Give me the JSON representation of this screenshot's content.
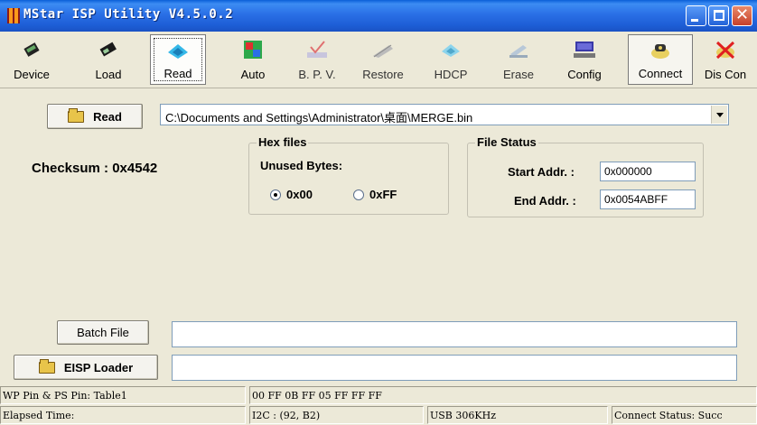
{
  "window": {
    "title": "MStar ISP Utility V4.5.0.2"
  },
  "toolbar": [
    {
      "label": "Device",
      "icon": "device-icon"
    },
    {
      "label": "Load",
      "icon": "load-icon"
    },
    {
      "label": "Read",
      "icon": "read-icon"
    },
    {
      "label": "Auto",
      "icon": "auto-icon"
    },
    {
      "label": "B. P. V.",
      "icon": "bpv-icon"
    },
    {
      "label": "Restore",
      "icon": "restore-icon"
    },
    {
      "label": "HDCP",
      "icon": "hdcp-icon"
    },
    {
      "label": "Erase",
      "icon": "erase-icon"
    },
    {
      "label": "Config",
      "icon": "config-icon"
    },
    {
      "label": "Connect",
      "icon": "connect-icon"
    },
    {
      "label": "Dis Con",
      "icon": "disconnect-icon"
    }
  ],
  "read_panel": {
    "read_button": "Read",
    "file_path": "C:\\Documents and Settings\\Administrator\\桌面\\MERGE.bin",
    "checksum": "Checksum : 0x4542"
  },
  "hex_files": {
    "legend": "Hex files",
    "unused_label": "Unused Bytes:",
    "option_00": "0x00",
    "option_ff": "0xFF"
  },
  "file_status": {
    "legend": "File Status",
    "start_label": "Start Addr. :",
    "start_value": "0x000000",
    "end_label": "End Addr. :",
    "end_value": "0x0054ABFF"
  },
  "bottom": {
    "batch_button": "Batch File",
    "batch_value": "",
    "eisp_button": "EISP Loader",
    "eisp_value": ""
  },
  "status_bar": {
    "wp_pin": "WP Pin & PS Pin: Table1",
    "hex_bytes": "00  FF  0B  FF  05  FF  FF  FF",
    "elapsed": "Elapsed Time:",
    "i2c": "I2C :  (92, B2)",
    "usb": "USB  306KHz",
    "connect_status": "Connect Status: Succ"
  },
  "colors": {
    "title_bar": "#2a6fe6",
    "face": "#ece9d8",
    "field_border": "#7f9db9"
  }
}
